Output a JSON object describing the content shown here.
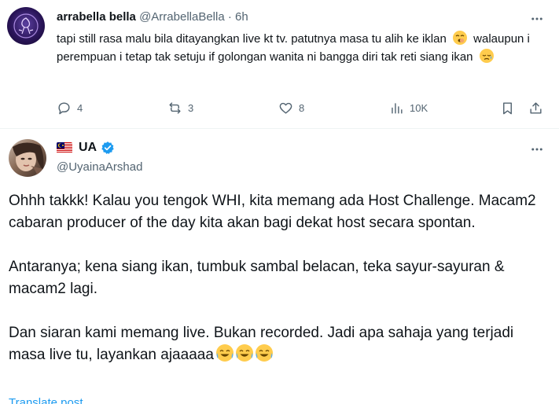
{
  "reply": {
    "display_name": "arrabella bella",
    "handle": "@ArrabellaBella",
    "separator": "·",
    "time": "6h",
    "text_part1": "tapi still rasa malu bila ditayangkan live kt tv. patutnya masa tu alih ke iklan",
    "text_part2": "walaupun i perempuan i tetap tak setuju if golongan wanita ni bangga diri tak reti siang ikan",
    "emoji1": "yawning-face",
    "emoji2": "sad-relieved-face",
    "actions": {
      "reply_count": "4",
      "repost_count": "3",
      "like_count": "8",
      "views_count": "10K"
    }
  },
  "tweet": {
    "flag": "malaysia-flag",
    "display_name": "UA",
    "handle": "@UyainaArshad",
    "paragraph1": "Ohhh takkk! Kalau you tengok WHI, kita memang ada Host Challenge. Macam2 cabaran producer of the day kita akan bagi dekat host secara spontan.",
    "paragraph2": "Antaranya; kena siang ikan, tumbuk sambal belacan, teka sayur-sayuran & macam2 lagi.",
    "paragraph3": "Dan siaran kami memang live. Bukan recorded. Jadi apa sahaja yang terjadi masa live tu, layankan ajaaaaa",
    "paragraph3_emoji": "face-with-tears-of-joy",
    "translate_label": "Translate post"
  },
  "colors": {
    "text": "#0f1419",
    "secondary": "#536471",
    "accent": "#1d9bf0",
    "divider": "#eff3f4"
  }
}
